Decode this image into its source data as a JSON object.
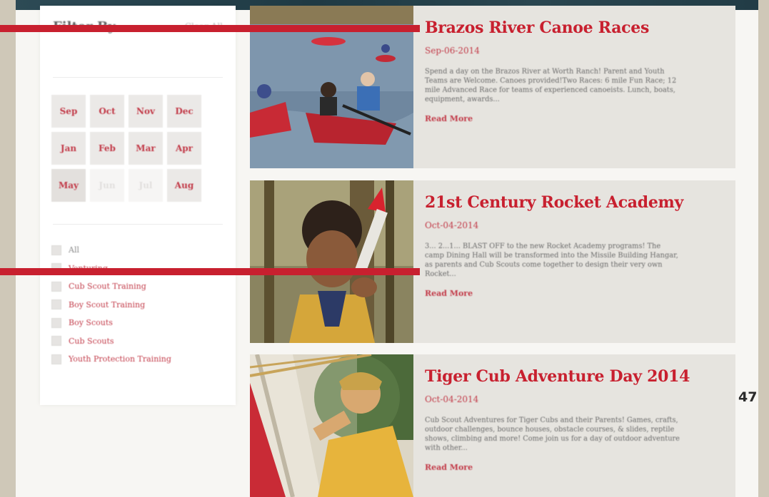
{
  "sidebar": {
    "title": "Filter By",
    "clear_label": "Clear All",
    "months": [
      {
        "label": "Sep",
        "state": "active"
      },
      {
        "label": "Oct",
        "state": "active"
      },
      {
        "label": "Nov",
        "state": "active"
      },
      {
        "label": "Dec",
        "state": "active"
      },
      {
        "label": "Jan",
        "state": "active"
      },
      {
        "label": "Feb",
        "state": "active"
      },
      {
        "label": "Mar",
        "state": "active"
      },
      {
        "label": "Apr",
        "state": "active"
      },
      {
        "label": "May",
        "state": "selected"
      },
      {
        "label": "Jun",
        "state": "disabled"
      },
      {
        "label": "Jul",
        "state": "disabled"
      },
      {
        "label": "Aug",
        "state": "active"
      }
    ],
    "categories": [
      {
        "label": "All"
      },
      {
        "label": "Venturing"
      },
      {
        "label": "Cub Scout Training"
      },
      {
        "label": "Boy Scout Training"
      },
      {
        "label": "Boy Scouts"
      },
      {
        "label": "Cub Scouts"
      },
      {
        "label": "Youth Protection Training"
      }
    ]
  },
  "events": [
    {
      "title": "Brazos River Canoe Races",
      "date": "Sep-06-2014",
      "description": "Spend a day on the Brazos River at Worth Ranch! Parent and Youth Teams are Welcome. Canoes provided!Two Races: 6 mile Fun Race; 12 mile Advanced Race for teams of experienced canoeists. Lunch, boats, equipment, awards...",
      "read_more": "Read More"
    },
    {
      "title": "21st Century Rocket Academy",
      "date": "Oct-04-2014",
      "description": "3... 2...1... BLAST OFF to the new Rocket Academy programs! The camp Dining Hall will be transformed into the Missile Building Hangar, as parents and Cub Scouts come together to design their very own Rocket...",
      "read_more": "Read More"
    },
    {
      "title": "Tiger Cub Adventure Day 2014",
      "date": "Oct-04-2014",
      "description": "Cub Scout Adventures for Tiger Cubs and their Parents! Games, crafts, outdoor challenges, bounce houses, obstacle courses, & slides, reptile shows, climbing and more! Come join us for a day of outdoor adventure with other...",
      "read_more": "Read More"
    }
  ],
  "page_number": "47",
  "colors": {
    "accent_red": "#c8202f",
    "card_bg": "#e6e4df",
    "top_band": "#1f3a44"
  }
}
